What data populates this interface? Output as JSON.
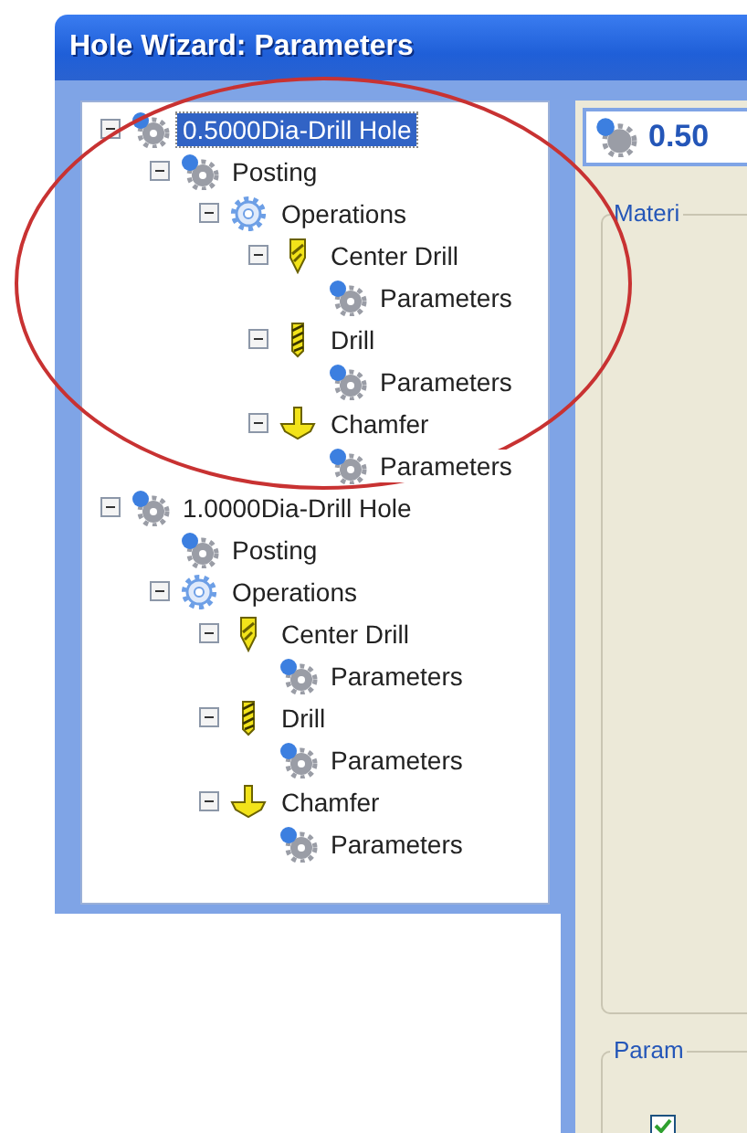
{
  "window": {
    "title": "Hole Wizard: Parameters"
  },
  "tree": [
    {
      "label": "0.5000Dia-Drill Hole",
      "kind": "hole",
      "selected": true,
      "expanded": true,
      "children": [
        {
          "label": "Posting",
          "kind": "hole",
          "selected": false,
          "expanded": true,
          "children": [
            {
              "label": "Operations",
              "kind": "operations",
              "selected": false,
              "expanded": true,
              "children": [
                {
                  "label": "Center Drill",
                  "kind": "center-drill",
                  "selected": false,
                  "expanded": true,
                  "children": [
                    {
                      "label": "Parameters",
                      "kind": "hole",
                      "selected": false
                    }
                  ]
                },
                {
                  "label": "Drill",
                  "kind": "drill",
                  "selected": false,
                  "expanded": true,
                  "children": [
                    {
                      "label": "Parameters",
                      "kind": "hole",
                      "selected": false
                    }
                  ]
                },
                {
                  "label": "Chamfer",
                  "kind": "chamfer",
                  "selected": false,
                  "expanded": true,
                  "children": [
                    {
                      "label": "Parameters",
                      "kind": "hole",
                      "selected": false
                    }
                  ]
                }
              ]
            }
          ]
        }
      ]
    },
    {
      "label": "1.0000Dia-Drill Hole",
      "kind": "hole",
      "selected": false,
      "expanded": true,
      "children": [
        {
          "label": "Posting",
          "kind": "hole",
          "selected": false
        },
        {
          "label": "Operations",
          "kind": "operations",
          "selected": false,
          "expanded": true,
          "children": [
            {
              "label": "Center Drill",
              "kind": "center-drill",
              "selected": false,
              "expanded": true,
              "children": [
                {
                  "label": "Parameters",
                  "kind": "hole",
                  "selected": false
                }
              ]
            },
            {
              "label": "Drill",
              "kind": "drill",
              "selected": false,
              "expanded": true,
              "children": [
                {
                  "label": "Parameters",
                  "kind": "hole",
                  "selected": false
                }
              ]
            },
            {
              "label": "Chamfer",
              "kind": "chamfer",
              "selected": false,
              "expanded": true,
              "children": [
                {
                  "label": "Parameters",
                  "kind": "hole",
                  "selected": false
                }
              ]
            }
          ]
        }
      ]
    }
  ],
  "detail": {
    "header": "0.50",
    "groups": [
      {
        "legend": "Materi"
      },
      {
        "legend": "Param",
        "checked": true
      }
    ]
  },
  "annotation": {
    "kind": "ellipse"
  }
}
